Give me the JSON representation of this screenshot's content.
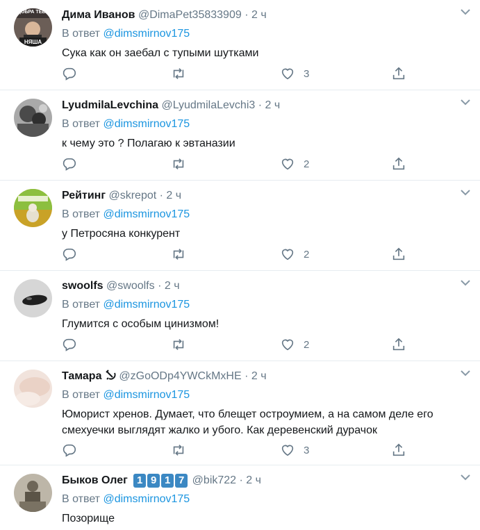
{
  "tweets": [
    {
      "name": "Дима Иванов",
      "handle": "@DimaPet35833909",
      "dot": "·",
      "time": "2 ч",
      "reply_prefix": "В ответ",
      "reply_to": "@dimsmirnov175",
      "text": "Сука как он заебал с тупыми шутками",
      "likes": "3",
      "avatar_caption_top": "ДОБРА ТЕБЕ",
      "avatar_caption_bottom": "НЯША"
    },
    {
      "name": "LyudmilaLevchina",
      "handle": "@LyudmilaLevchi3",
      "dot": "·",
      "time": "2 ч",
      "reply_prefix": "В ответ",
      "reply_to": "@dimsmirnov175",
      "text": "к чему это ? Полагаю к эвтаназии",
      "likes": "2"
    },
    {
      "name": "Рейтинг",
      "handle": "@skrepot",
      "dot": "·",
      "time": "2 ч",
      "reply_prefix": "В ответ",
      "reply_to": "@dimsmirnov175",
      "text": "у Петросяна конкурент",
      "likes": "2"
    },
    {
      "name": "swoolfs",
      "handle": "@swoolfs",
      "dot": "·",
      "time": "2 ч",
      "reply_prefix": "В ответ",
      "reply_to": "@dimsmirnov175",
      "text": "Глумится с особым цинизмом!",
      "likes": "2"
    },
    {
      "name": "Тамара",
      "name_emoji": "hammer-and-sickle-icon",
      "handle": "@zGoODp4YWCkMxHE",
      "dot": "·",
      "time": "2 ч",
      "reply_prefix": "В ответ",
      "reply_to": "@dimsmirnov175",
      "text": "Юморист хренов. Думает, что  блещет остроумием, а на самом деле его смехуечки выглядят жалко и убого. Как деревенский дурачок",
      "likes": "3"
    },
    {
      "name": "Быков Олег",
      "badges": [
        "1",
        "9",
        "1",
        "7"
      ],
      "handle": "@bik722",
      "dot": "·",
      "time": "2 ч",
      "reply_prefix": "В ответ",
      "reply_to": "@dimsmirnov175",
      "text": "Позорище"
    }
  ],
  "colors": {
    "accent": "#1b95e0",
    "muted": "#657786",
    "border": "#e6ecf0",
    "badge": "#3b88c3"
  }
}
